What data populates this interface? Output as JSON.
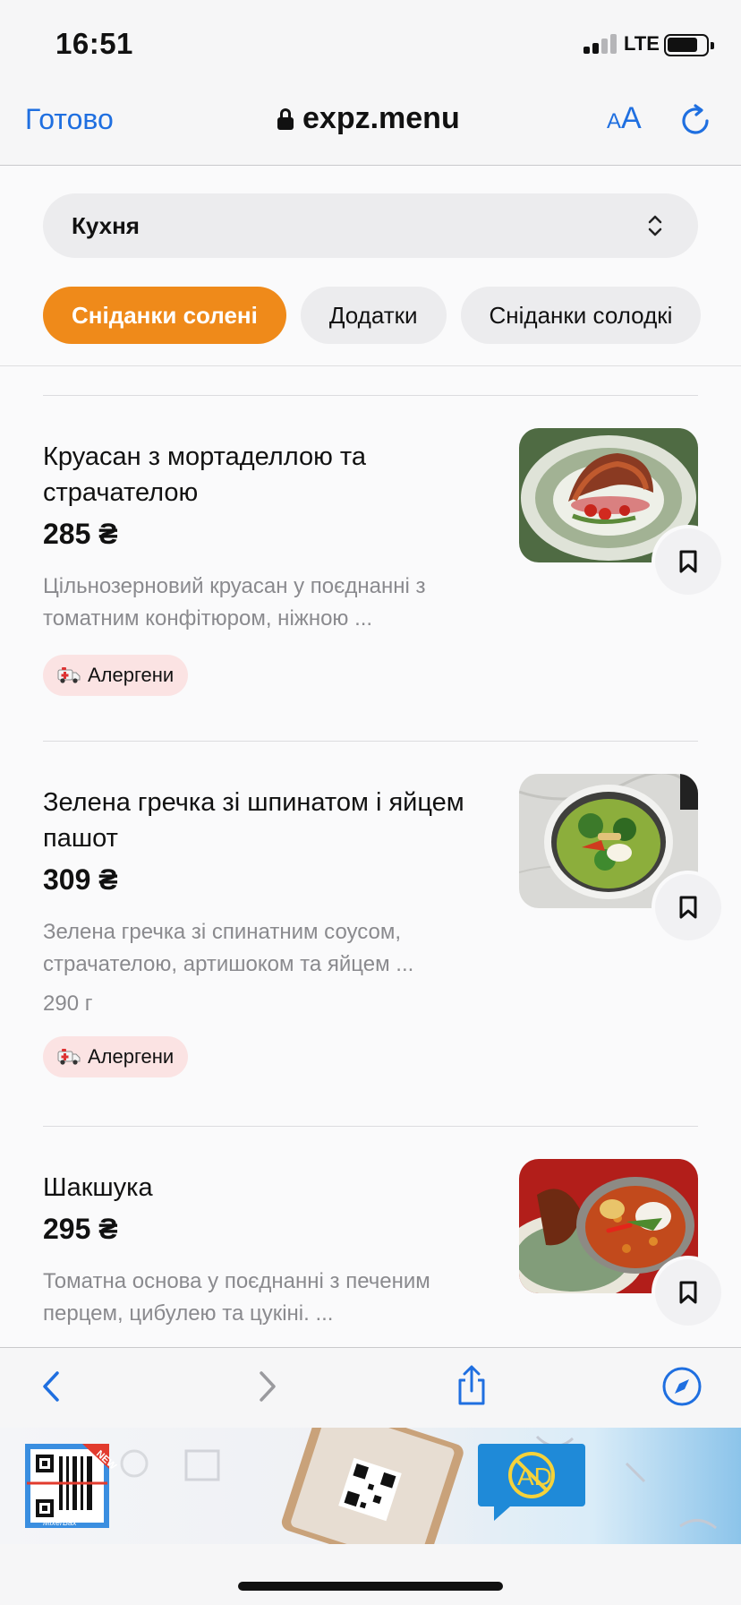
{
  "status_bar": {
    "time": "16:51",
    "network": "LTE"
  },
  "browser": {
    "done_label": "Готово",
    "url": "expz.menu",
    "text_size_small": "A",
    "text_size_large": "A"
  },
  "menu": {
    "category_select": "Кухня",
    "chips": [
      "Сніданки солені",
      "Додатки",
      "Сніданки солодкі"
    ],
    "active_chip": "Сніданки солені"
  },
  "items": [
    {
      "title": "Круасан з мортаделлою та страчателою",
      "price": "285 ₴",
      "description": " Цільнозерновий круасан у поєднанні з томатним конфітюром, ніжною ...",
      "allergen_label": "Алергени"
    },
    {
      "title": "Зелена гречка зі шпинатом і яйцем пашот",
      "price": "309 ₴",
      "description": "Зелена гречка зі спинатним соусом, страчателою, артишоком та яйцем ...",
      "weight": "290 г",
      "allergen_label": "Алергени"
    },
    {
      "title": "Шакшука",
      "price": "295 ₴",
      "description": " Томатна основа у поєднанні з печеним перцем, цибулею та цукіні. ..."
    }
  ],
  "ad": {
    "badge": "NEW",
    "brand": "MixerBax",
    "ad_text": "AD"
  },
  "colors": {
    "accent": "#ef8a1a",
    "link": "#1f6fe0",
    "allergen_bg": "#fbe3e3"
  }
}
